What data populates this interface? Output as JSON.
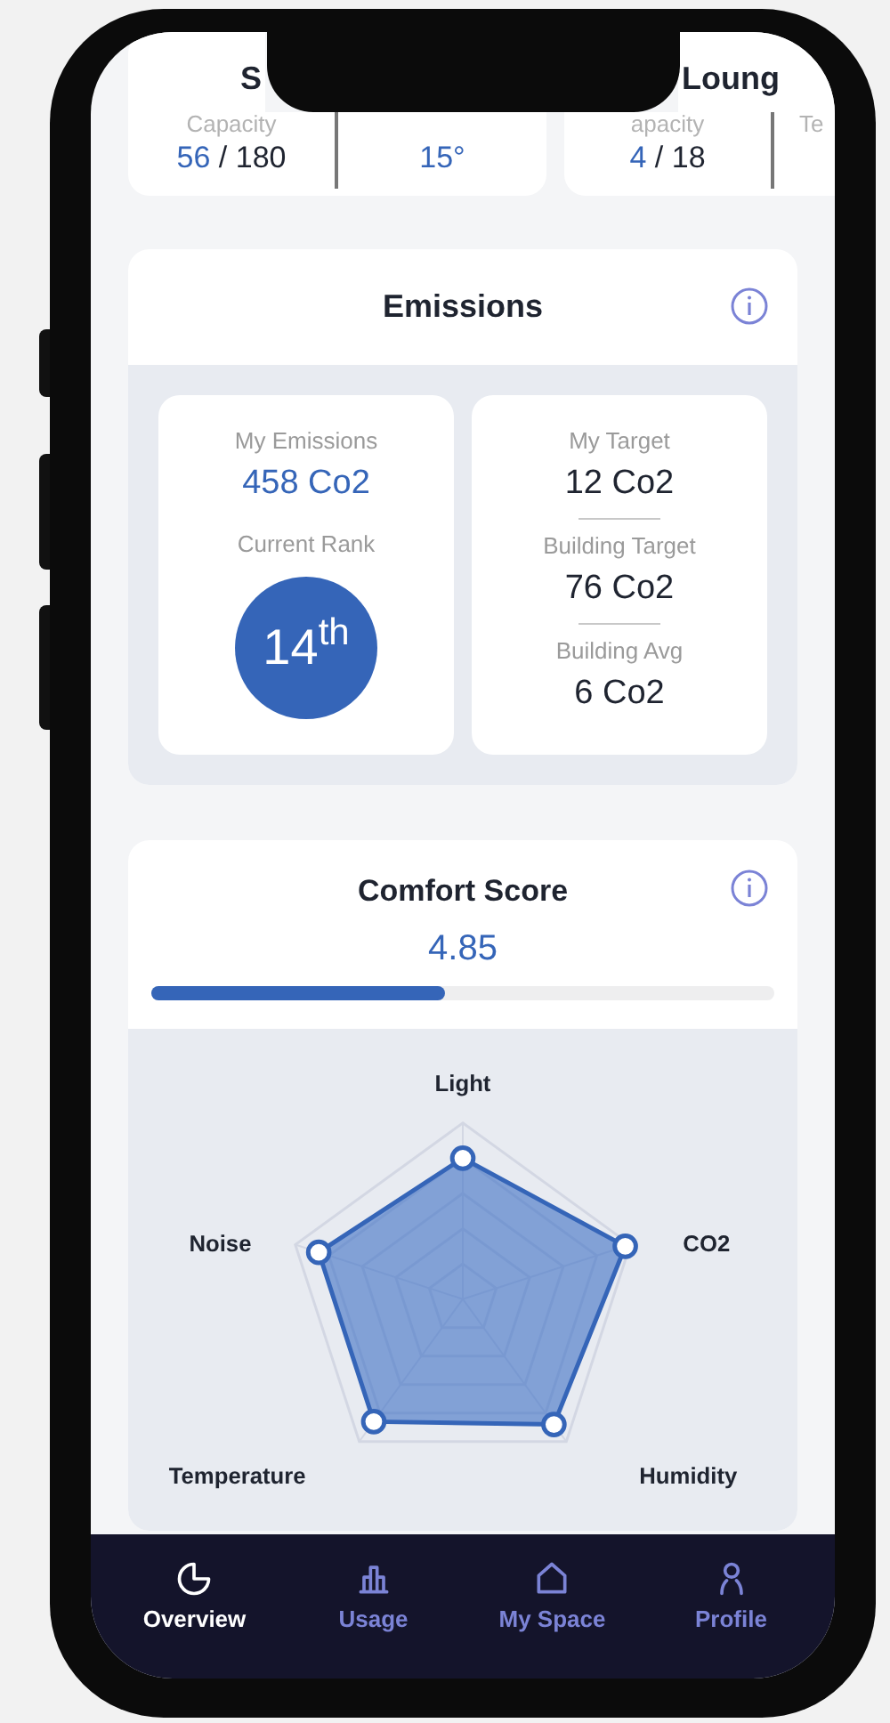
{
  "top_cards": [
    {
      "title": "S",
      "stats": [
        {
          "label": "Capacity",
          "value": "56",
          "total": "/ 180"
        },
        {
          "value": "15°"
        }
      ]
    },
    {
      "title": "Loung",
      "stats": [
        {
          "label": "apacity",
          "value": "4",
          "total": "/ 18"
        },
        {
          "label": "Te"
        }
      ]
    }
  ],
  "emissions": {
    "title": "Emissions",
    "my_emissions": {
      "label": "My Emissions",
      "value": "458 Co2"
    },
    "rank": {
      "label": "Current Rank",
      "value": "14$^{th}$"
    },
    "targets": [
      {
        "label": "My Target",
        "value": "12 Co2"
      },
      {
        "label": "Building Target",
        "value": "76 Co2"
      },
      {
        "label": "Building Avg",
        "value": "6 Co2"
      }
    ]
  },
  "comfort": {
    "title": "Comfort Score",
    "score": "4.85",
    "level": 0.47,
    "radar_axes": [
      "Light",
      "CO2",
      "Humidity",
      "Temperature",
      "Noise"
    ]
  },
  "nav": [
    {
      "label": "Overview",
      "selected": true,
      "kind": "chart"
    },
    {
      "label": "Usage",
      "selected": false,
      "kind": "bars"
    },
    {
      "label": "My Space",
      "selected": false,
      "kind": "home"
    },
    {
      "label": "Profile",
      "selected": false,
      "kind": "person"
    }
  ]
}
